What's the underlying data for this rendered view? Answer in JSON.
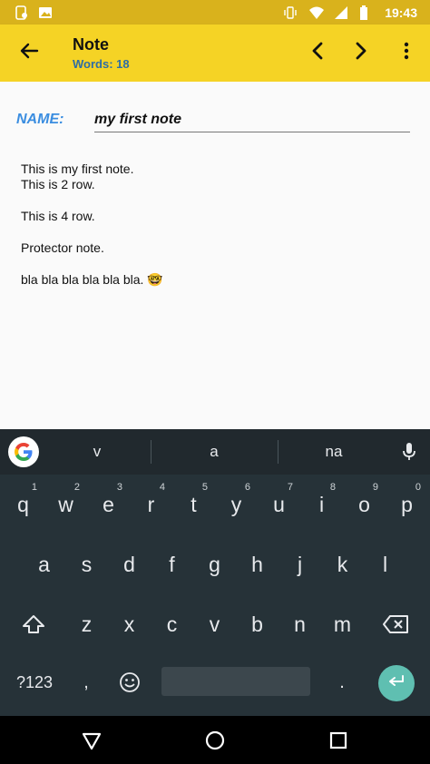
{
  "status_bar": {
    "time": "19:43",
    "icons": [
      "notification-icon",
      "image-icon",
      "vibrate-icon",
      "wifi-icon",
      "signal-icon",
      "battery-icon"
    ]
  },
  "app_bar": {
    "title": "Note",
    "subtitle": "Words: 18",
    "icons": [
      "arrow-back-icon",
      "chevron-left-icon",
      "chevron-right-icon",
      "more-vert-icon"
    ]
  },
  "note": {
    "name_label": "NAME:",
    "name_value": "my first note",
    "lines": [
      "This is my first note.",
      "This is 2 row.",
      "",
      "This is 4 row.",
      "",
      "Protector note.",
      "",
      "bla bla bla bla bla bla. 🤓"
    ]
  },
  "keyboard": {
    "suggestions": [
      "v",
      "a",
      "na"
    ],
    "row1": [
      {
        "key": "q",
        "hint": "1"
      },
      {
        "key": "w",
        "hint": "2"
      },
      {
        "key": "e",
        "hint": "3"
      },
      {
        "key": "r",
        "hint": "4"
      },
      {
        "key": "t",
        "hint": "5"
      },
      {
        "key": "y",
        "hint": "6"
      },
      {
        "key": "u",
        "hint": "7"
      },
      {
        "key": "i",
        "hint": "8"
      },
      {
        "key": "o",
        "hint": "9"
      },
      {
        "key": "p",
        "hint": "0"
      }
    ],
    "row2": [
      "a",
      "s",
      "d",
      "f",
      "g",
      "h",
      "j",
      "k",
      "l"
    ],
    "row3": [
      "z",
      "x",
      "c",
      "v",
      "b",
      "n",
      "m"
    ],
    "mode_key": "?123",
    "comma": ",",
    "period": ".",
    "colors": {
      "background": "#263238",
      "enter": "#5fbfb1"
    }
  },
  "colors": {
    "app_bar": "#f5d325",
    "status_bar": "#d9b21c",
    "subtitle": "#2e6da4",
    "name_label": "#3a8de0"
  }
}
